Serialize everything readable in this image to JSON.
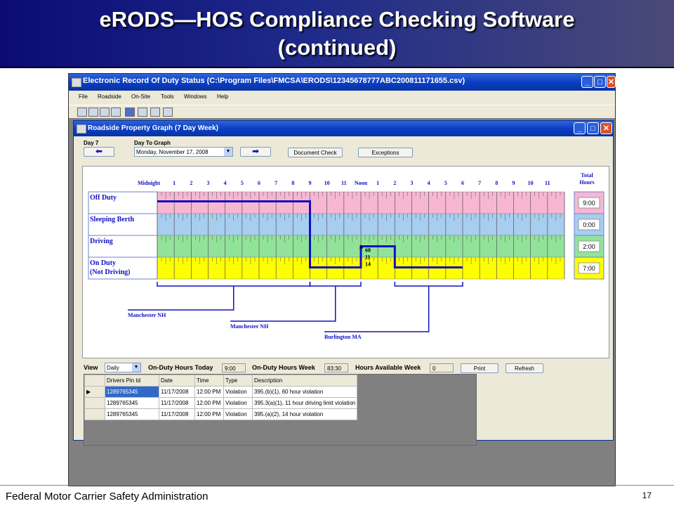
{
  "slide": {
    "title_line1": "eRODS—HOS Compliance Checking Software",
    "title_line2": "(continued)",
    "footer": "Federal Motor Carrier Safety Administration",
    "page_number": "17"
  },
  "app": {
    "title": "Electronic Record Of Duty Status (C:\\Program Files\\FMCSA\\ERODS\\12345678777ABC200811171655.csv)",
    "menu": [
      "File",
      "Roadside",
      "On-Site",
      "Tools",
      "Windows",
      "Help"
    ],
    "toolbar_icons": [
      "truck-icon",
      "bus-icon",
      "car-icon",
      "form-icon",
      "calendar-icon",
      "chart-icon",
      "report-icon",
      "print-icon"
    ]
  },
  "child": {
    "title": "Roadside Property Graph (7 Day Week)",
    "day_label": "Day 7",
    "day_to_graph_label": "Day To Graph",
    "day_to_graph_value": "Monday, November 17, 2008",
    "document_check": "Document Check",
    "exceptions": "Exceptions"
  },
  "graph": {
    "hours": [
      "Midnight",
      "1",
      "2",
      "3",
      "4",
      "5",
      "6",
      "7",
      "8",
      "9",
      "10",
      "11",
      "Noon",
      "1",
      "2",
      "3",
      "4",
      "5",
      "6",
      "7",
      "8",
      "9",
      "10",
      "11"
    ],
    "total_label": [
      "Total",
      "Hours"
    ],
    "rows": [
      {
        "label": "Off Duty",
        "total": "9:00",
        "color": "#f7b7d3"
      },
      {
        "label": "Sleeping Berth",
        "total": "0:00",
        "color": "#a7cdef"
      },
      {
        "label": "Driving",
        "total": "2:00",
        "color": "#92e39a"
      },
      {
        "label": "On Duty",
        "label2": "(Not Driving)",
        "total": "7:00",
        "color": "#ffff00"
      }
    ],
    "line_color": "#1010c0",
    "duty_segments": [
      {
        "status": 0,
        "start": 0,
        "end": 9
      },
      {
        "status": 3,
        "start": 9,
        "end": 12
      },
      {
        "status": 2,
        "start": 12,
        "end": 14
      },
      {
        "status": 3,
        "start": 14,
        "end": 18
      }
    ],
    "violation_labels": [
      "60",
      "11",
      "14"
    ],
    "violation_hour": 12,
    "locations": [
      {
        "name": "Manchester NH",
        "start": 0,
        "end": 9
      },
      {
        "name": "Manchester NH",
        "start": 9,
        "end": 12
      },
      {
        "name": "Burlington MA",
        "start": 14,
        "end": 18
      }
    ]
  },
  "bottom": {
    "view_label": "View",
    "view_value": "Daily",
    "on_duty_today_label": "On-Duty Hours Today",
    "on_duty_today": "9:00",
    "on_duty_week_label": "On-Duty Hours Week",
    "on_duty_week": "83:30",
    "hours_available_label": "Hours Available Week",
    "hours_available": "0",
    "print": "Print",
    "refresh": "Refresh"
  },
  "table": {
    "columns": [
      "Drivers Pin Id",
      "Date",
      "Time",
      "Type",
      "Description"
    ],
    "rows": [
      [
        "1289765345",
        "11/17/2008",
        "12:00 PM",
        "Violation",
        "395.(b)(1), 60 hour violation"
      ],
      [
        "1289765345",
        "11/17/2008",
        "12:00 PM",
        "Violation",
        "395.3(a)(1), 11 hour driving limit violation"
      ],
      [
        "1289765345",
        "11/17/2008",
        "12:00 PM",
        "Violation",
        "395.(a)(2), 14 hour violation"
      ]
    ]
  }
}
